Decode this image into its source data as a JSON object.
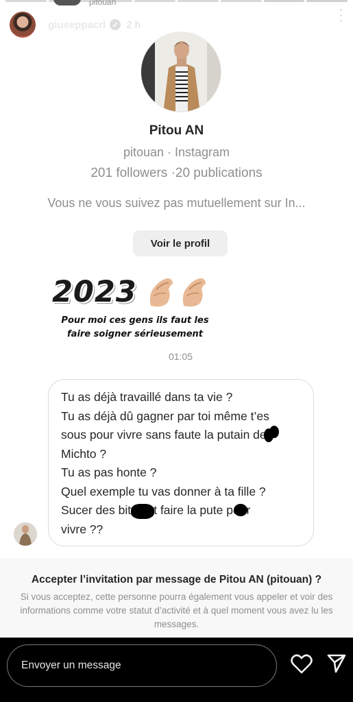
{
  "story_header": {
    "top_text": "pitouan",
    "username": "giuseppacrl",
    "verified_icon": "verified-check-icon",
    "time": "2 h",
    "more_icon": "more-vertical-icon"
  },
  "shared_profile": {
    "name": "Pitou AN",
    "handle_line": "pitouan · Instagram",
    "stats": "201 followers ·20 publications",
    "mutual_text": "Vous ne vous suivez pas mutuellement sur In...",
    "view_profile_label": "Voir le profil"
  },
  "overlay": {
    "year": "2023",
    "hands_icon": "pinched-fingers-emoji",
    "caption": "Pour moi ces gens ils faut les faire soigner sérieusement"
  },
  "message": {
    "time": "01:05",
    "lines": [
      "Tu as déjà travaillé dans ta vie ?",
      "Tu as déjà dû gagner par toi même t’es",
      "sous pour vivre sans faute la putain de",
      "Michto ?",
      "Tu as pas honte ?",
      "Quel exemple tu vas donner à ta fille ?",
      "Sucer des bites et faire la pute pour",
      "vivre ??"
    ]
  },
  "invite": {
    "title": "Accepter l’invitation par message de Pitou AN (pitouan) ?",
    "text": "Si vous acceptez, cette personne pourra également vous appeler et voir des informations comme votre statut d’activité et à quel moment vous avez lu les messages."
  },
  "reply_bar": {
    "placeholder": "Envoyer un message",
    "like_icon": "heart-icon",
    "send_icon": "send-icon"
  },
  "colors": {
    "text_primary": "#262626",
    "text_secondary": "#8e8e8e",
    "button_bg": "#efefef",
    "invite_bg": "#f8f8f8",
    "bottom_bg": "#000000"
  }
}
